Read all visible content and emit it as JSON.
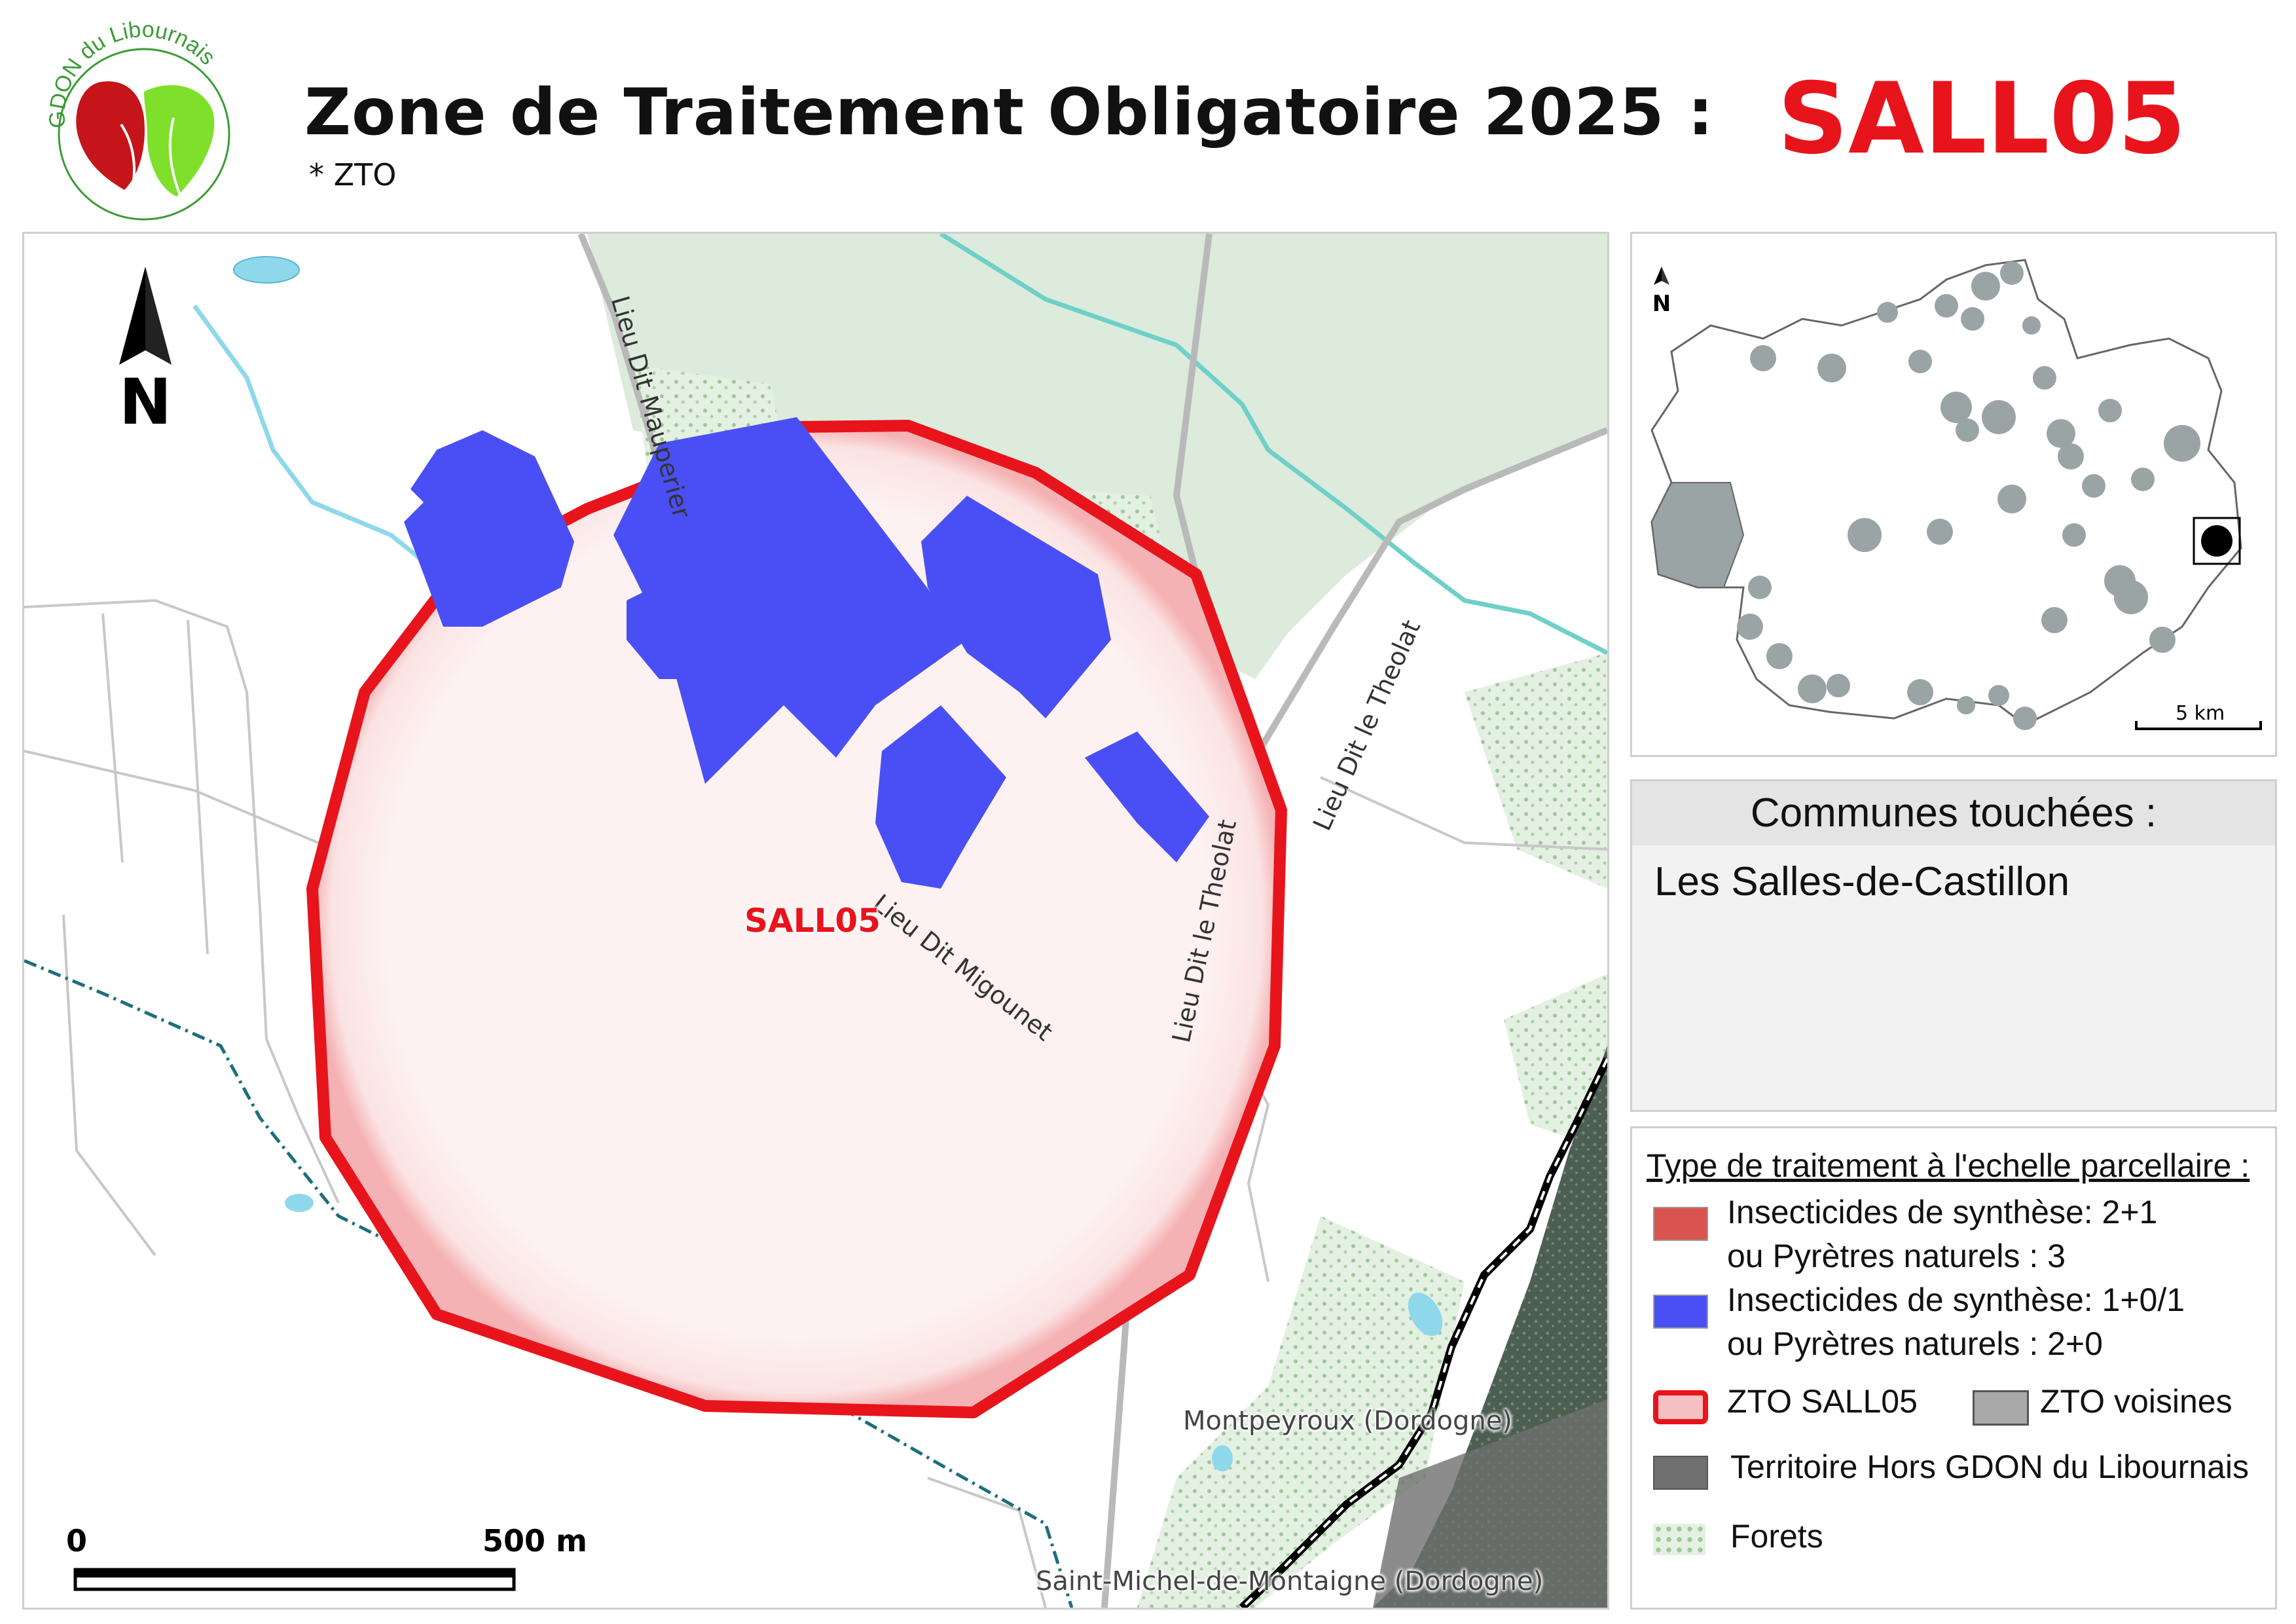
{
  "header": {
    "logo_text": "GDON du Libournais",
    "title": "Zone de Traitement Obligatoire 2025 :",
    "subtitle": "* ZTO",
    "zone_code": "SALL05"
  },
  "map": {
    "north_label": "N",
    "zone_label": "SALL05",
    "road_labels": [
      "Lieu Dit Mauperier",
      "Lieu Dit Migounet",
      "Lieu Dit le Theolat",
      "Lieu Dit le Theolat"
    ],
    "place_labels": [
      "Montpeyroux (Dordogne)",
      "Saint-Michel-de-Montaigne (Dordogne)"
    ],
    "scale": {
      "start": "0",
      "end": "500 m"
    }
  },
  "inset": {
    "north_label": "N",
    "scale_label": "5 km"
  },
  "communes": {
    "title": "Communes touchées :",
    "items": [
      "Les Salles-de-Castillon"
    ]
  },
  "legend": {
    "title": "Type de traitement à l'echelle parcellaire :",
    "items": [
      {
        "color": "#d9534f",
        "line1": "Insecticides de synthèse: 2+1",
        "line2": "ou Pyrètres naturels : 3"
      },
      {
        "color": "#4a4ff5",
        "line1": "Insecticides de synthèse: 1+0/1",
        "line2": "ou Pyrètres naturels : 2+0"
      }
    ],
    "zto_label": "ZTO SALL05",
    "zto_neighbors_label": "ZTO voisines",
    "outside_label": "Territoire Hors GDON du Libournais",
    "forest_label": "Forets"
  },
  "colors": {
    "zone_outline": "#e8141c",
    "parcel_blue": "#4a4ff5",
    "forest": "#dcebdc",
    "outside": "#6f6f6f",
    "water": "#8fd8ec"
  }
}
